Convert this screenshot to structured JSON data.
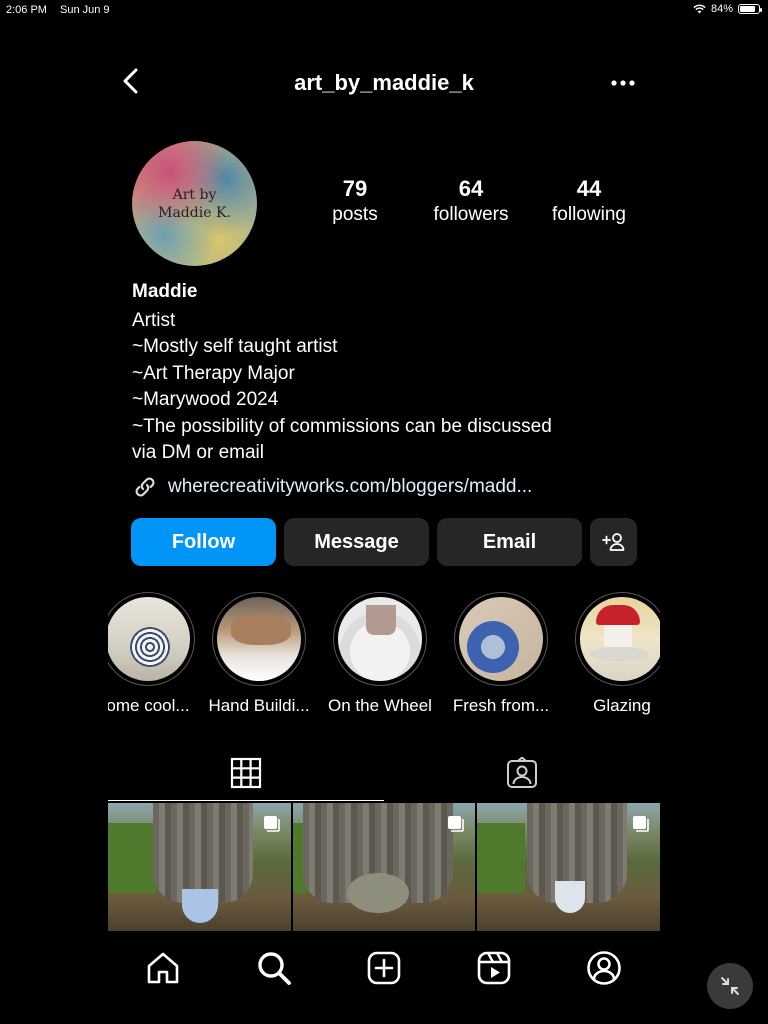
{
  "status": {
    "time": "2:06 PM",
    "date": "Sun Jun 9",
    "battery": "84%",
    "battery_level": 0.84
  },
  "header": {
    "username": "art_by_maddie_k"
  },
  "avatar": {
    "line1": "Art by",
    "line2": "Maddie K."
  },
  "stats": [
    {
      "num": "79",
      "label": "posts"
    },
    {
      "num": "64",
      "label": "followers"
    },
    {
      "num": "44",
      "label": "following"
    }
  ],
  "bio": {
    "name": "Maddie",
    "lines": [
      "Artist",
      "~Mostly self taught artist",
      "~Art Therapy Major",
      "~Marywood 2024",
      "~The possibility of commissions can be discussed",
      "via DM or email"
    ],
    "link": "wherecreativityworks.com/bloggers/madd..."
  },
  "buttons": {
    "follow": "Follow",
    "message": "Message",
    "email": "Email"
  },
  "highlights": [
    {
      "label": "ome cool..."
    },
    {
      "label": "Hand Buildi..."
    },
    {
      "label": "On the Wheel"
    },
    {
      "label": "Fresh from..."
    },
    {
      "label": "Glazing"
    }
  ],
  "tabs": [
    {
      "icon": "grid-icon"
    },
    {
      "icon": "tagged-icon"
    }
  ],
  "nav": [
    "home-icon",
    "search-icon",
    "create-icon",
    "reels-icon",
    "profile-icon"
  ],
  "colors": {
    "accent": "#0095f6",
    "button_dark": "#262626",
    "background": "#000000"
  }
}
